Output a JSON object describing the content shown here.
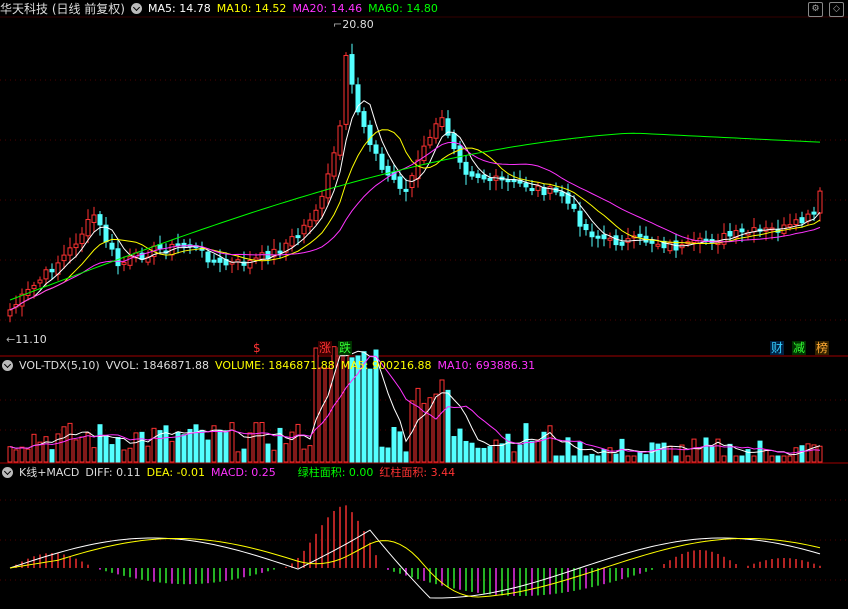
{
  "kline": {
    "title": "华天科技 (日线 前复权)",
    "ma": [
      {
        "label": "MA5: 14.78",
        "color": "#ffffff"
      },
      {
        "label": "MA10: 14.52",
        "color": "#ffff00"
      },
      {
        "label": "MA20: 14.46",
        "color": "#ff33ff"
      },
      {
        "label": "MA60: 14.80",
        "color": "#00ff00"
      }
    ],
    "high_label": "20.80",
    "low_label": "11.10",
    "events": [
      {
        "text": "$",
        "color": "#ff3333",
        "bg": "transparent"
      },
      {
        "text": "涨",
        "color": "#ff3333",
        "bg": "#3a0000"
      },
      {
        "text": "跌",
        "color": "#33ff33",
        "bg": "#003300"
      },
      {
        "text": "财",
        "color": "#33ccff",
        "bg": "#002244"
      },
      {
        "text": "减",
        "color": "#33ff33",
        "bg": "#003300"
      },
      {
        "text": "榜",
        "color": "#ffaa33",
        "bg": "#332200"
      }
    ]
  },
  "volume": {
    "title": "VOL-TDX(5,10)",
    "vvol": "VVOL: 1846871.88",
    "volume": "VOLUME: 1846871.88",
    "ma5": "MA5: 900216.88",
    "ma10": "MA10: 693886.31"
  },
  "macd": {
    "title": "K线+MACD",
    "diff": "DIFF: 0.11",
    "dea": "DEA: -0.01",
    "macd": "MACD: 0.25",
    "green_area": "绿柱面积: 0.00",
    "red_area": "红柱面积: 3.44"
  },
  "colors": {
    "up": "#ff3232",
    "down": "#54ffff",
    "ma5": "#ffffff",
    "ma10": "#ffff00",
    "ma20": "#ff33ff",
    "ma60": "#00ff00",
    "grid": "#a00000"
  }
}
